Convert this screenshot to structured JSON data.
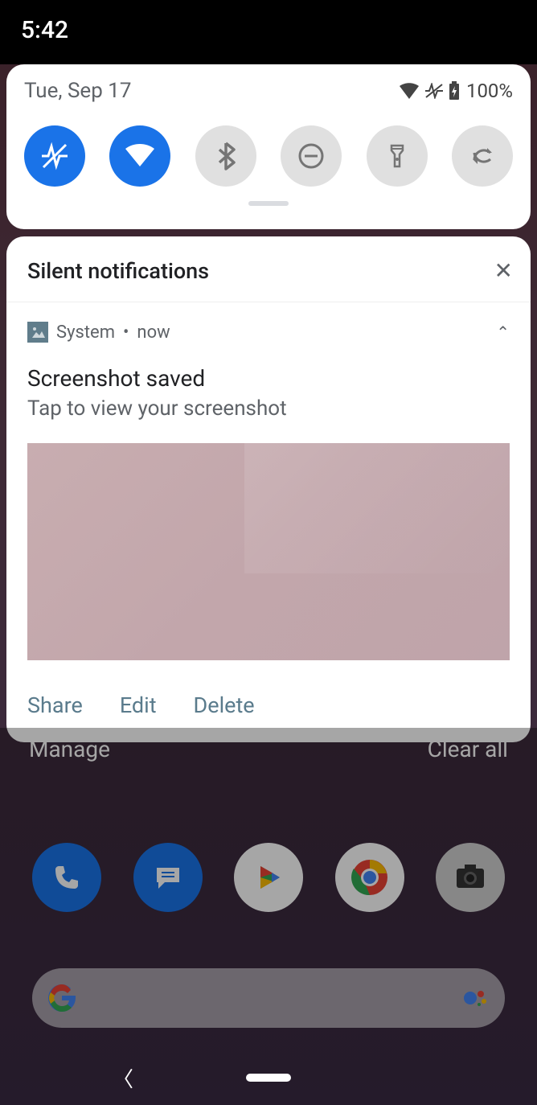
{
  "status": {
    "time": "5:42"
  },
  "qs": {
    "date": "Tue, Sep 17",
    "battery_text": "100%",
    "tiles": [
      {
        "name": "pulse",
        "active": true
      },
      {
        "name": "wifi",
        "active": true
      },
      {
        "name": "bluetooth",
        "active": false
      },
      {
        "name": "dnd",
        "active": false
      },
      {
        "name": "flashlight",
        "active": false
      },
      {
        "name": "rotate",
        "active": false
      }
    ]
  },
  "silent_header": "Silent notifications",
  "notification": {
    "app": "System",
    "sep": "•",
    "time": "now",
    "title": "Screenshot saved",
    "subtitle": "Tap to view your screenshot",
    "actions": {
      "share": "Share",
      "edit": "Edit",
      "delete": "Delete"
    }
  },
  "footer": {
    "manage": "Manage",
    "clear_all": "Clear all"
  }
}
